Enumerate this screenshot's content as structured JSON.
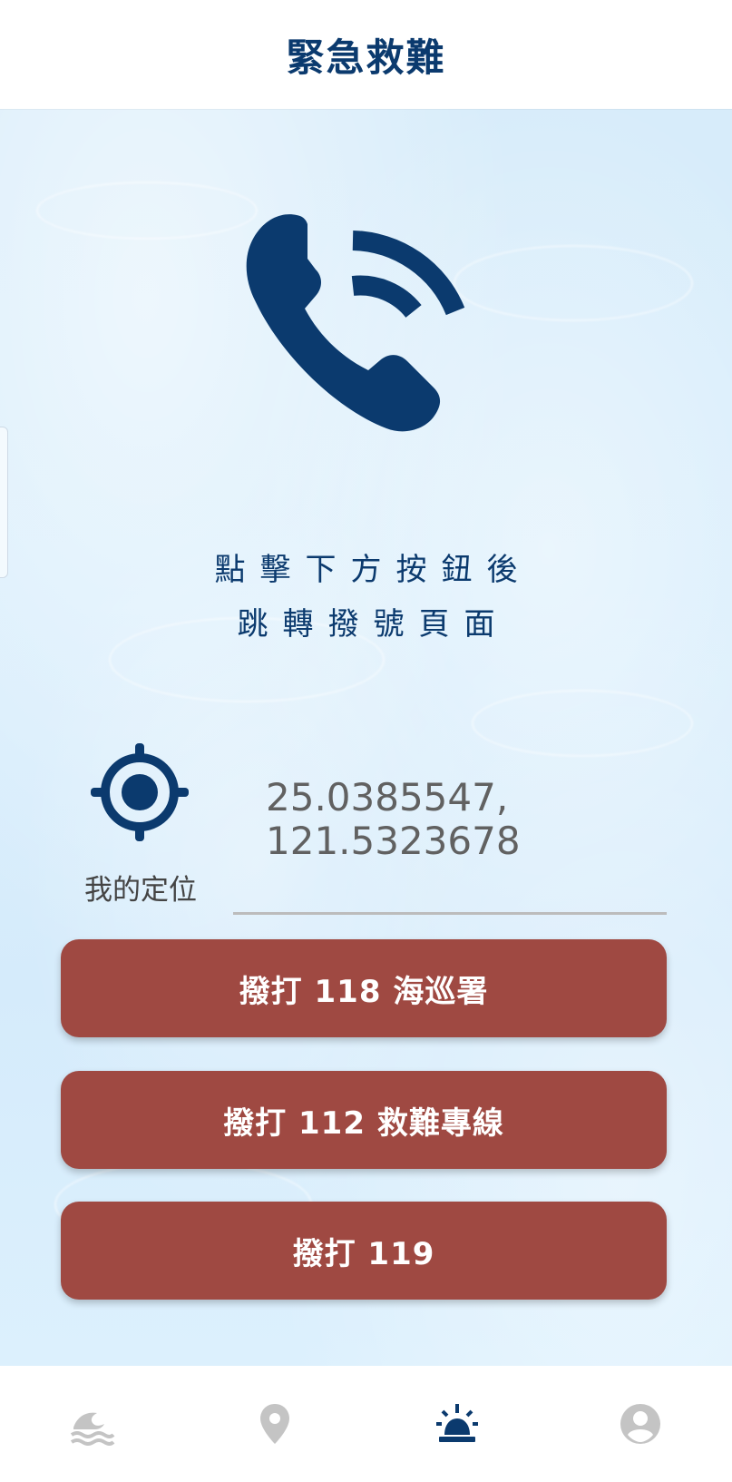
{
  "header": {
    "title": "緊急救難"
  },
  "instructions": {
    "line1": "點擊下方按鈕後",
    "line2": "跳轉撥號頁面"
  },
  "location": {
    "label": "我的定位",
    "value": "25.0385547,\n121.5323678"
  },
  "buttons": [
    {
      "label": "撥打 118 海巡署"
    },
    {
      "label": "撥打 112 救難專線"
    },
    {
      "label": "撥打 119"
    }
  ],
  "nav": {
    "items": [
      {
        "icon": "wave-icon",
        "active": false
      },
      {
        "icon": "map-pin-icon",
        "active": false
      },
      {
        "icon": "emergency-beacon-icon",
        "active": true
      },
      {
        "icon": "account-icon",
        "active": false
      }
    ]
  },
  "colors": {
    "primary": "#0b3a6e",
    "button": "#9f4942",
    "inactive_icon": "#c4c4c4",
    "background": "#d8edfb"
  }
}
